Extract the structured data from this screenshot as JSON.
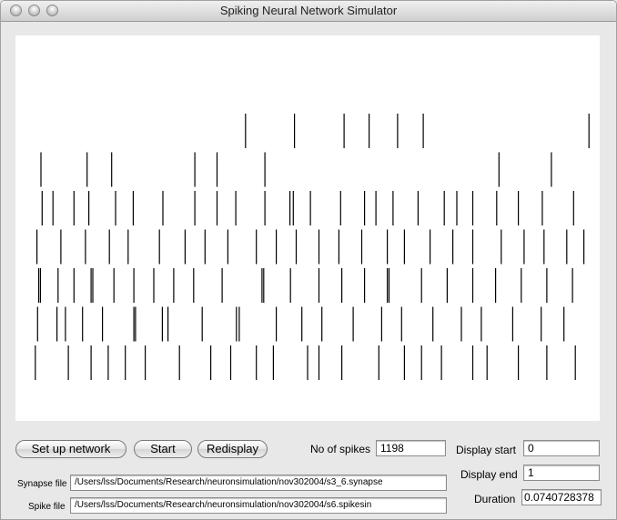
{
  "window": {
    "title": "Spiking Neural Network Simulator"
  },
  "buttons": {
    "setup": "Set up network",
    "start": "Start",
    "redisplay": "Redisplay"
  },
  "fields": {
    "no_of_spikes": {
      "label": "No of spikes",
      "value": "1198"
    },
    "display_start": {
      "label": "Display start",
      "value": "0"
    },
    "display_end": {
      "label": "Display end",
      "value": "1"
    },
    "duration": {
      "label": "Duration",
      "value": "0.0740728378"
    },
    "synapse_file": {
      "label": "Synapse file",
      "value": "/Users/lss/Documents/Research/neuronsimulation/nov302004/s3_6.synapse"
    },
    "spike_file": {
      "label": "Spike file",
      "value": "/Users/lss/Documents/Research/neuronsimulation/nov302004/s6.spikesin"
    }
  },
  "raster": {
    "display_range": [
      0,
      1
    ],
    "rows": [
      [
        0.391,
        0.477,
        0.564,
        0.608,
        0.658,
        0.703,
        0.994
      ],
      [
        0.032,
        0.113,
        0.156,
        0.302,
        0.341,
        0.425,
        0.836,
        0.928
      ],
      [
        0.034,
        0.053,
        0.09,
        0.116,
        0.163,
        0.194,
        0.246,
        0.302,
        0.341,
        0.374,
        0.425,
        0.469,
        0.475,
        0.505,
        0.558,
        0.6,
        0.62,
        0.65,
        0.694,
        0.74,
        0.762,
        0.79,
        0.832,
        0.87,
        0.912,
        0.967
      ],
      [
        0.025,
        0.067,
        0.11,
        0.152,
        0.185,
        0.24,
        0.285,
        0.32,
        0.36,
        0.41,
        0.445,
        0.48,
        0.52,
        0.555,
        0.595,
        0.64,
        0.67,
        0.715,
        0.755,
        0.79,
        0.84,
        0.88,
        0.915,
        0.955,
        0.985
      ],
      [
        0.028,
        0.031,
        0.062,
        0.09,
        0.12,
        0.123,
        0.16,
        0.195,
        0.23,
        0.265,
        0.3,
        0.35,
        0.42,
        0.423,
        0.47,
        0.52,
        0.56,
        0.6,
        0.64,
        0.643,
        0.7,
        0.745,
        0.79,
        0.83,
        0.875,
        0.92,
        0.965
      ],
      [
        0.026,
        0.06,
        0.075,
        0.105,
        0.14,
        0.195,
        0.198,
        0.245,
        0.255,
        0.315,
        0.375,
        0.38,
        0.445,
        0.49,
        0.525,
        0.58,
        0.63,
        0.665,
        0.72,
        0.77,
        0.805,
        0.86,
        0.91,
        0.95
      ],
      [
        0.022,
        0.08,
        0.12,
        0.15,
        0.18,
        0.215,
        0.275,
        0.33,
        0.365,
        0.41,
        0.44,
        0.5,
        0.52,
        0.56,
        0.625,
        0.67,
        0.7,
        0.735,
        0.79,
        0.815,
        0.87,
        0.92,
        0.97
      ]
    ]
  }
}
